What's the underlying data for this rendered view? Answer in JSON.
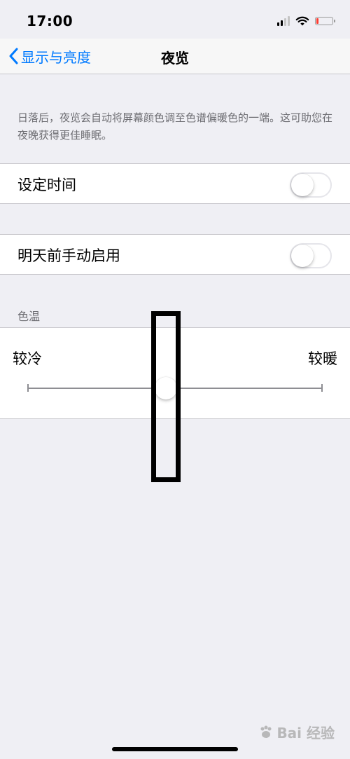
{
  "status_bar": {
    "time": "17:00",
    "battery_level": 0.12,
    "battery_color": "#ff3b30",
    "signal_bars": 4,
    "signal_bars_active": 2
  },
  "nav": {
    "back_label": "显示与亮度",
    "title": "夜览",
    "accent": "#007aff"
  },
  "description": "日落后，夜览会自动将屏幕颜色调至色谱偏暖色的一端。这可助您在夜晚获得更佳睡眠。",
  "settings": {
    "scheduled": {
      "label": "设定时间",
      "on": false
    },
    "manual": {
      "label": "明天前手动启用",
      "on": false
    }
  },
  "color_temperature": {
    "header": "色温",
    "cool_label": "较冷",
    "warm_label": "较暖",
    "value": 0.47
  },
  "watermark": {
    "text": "Bai 经验",
    "icon": "baidu-paw-icon"
  }
}
